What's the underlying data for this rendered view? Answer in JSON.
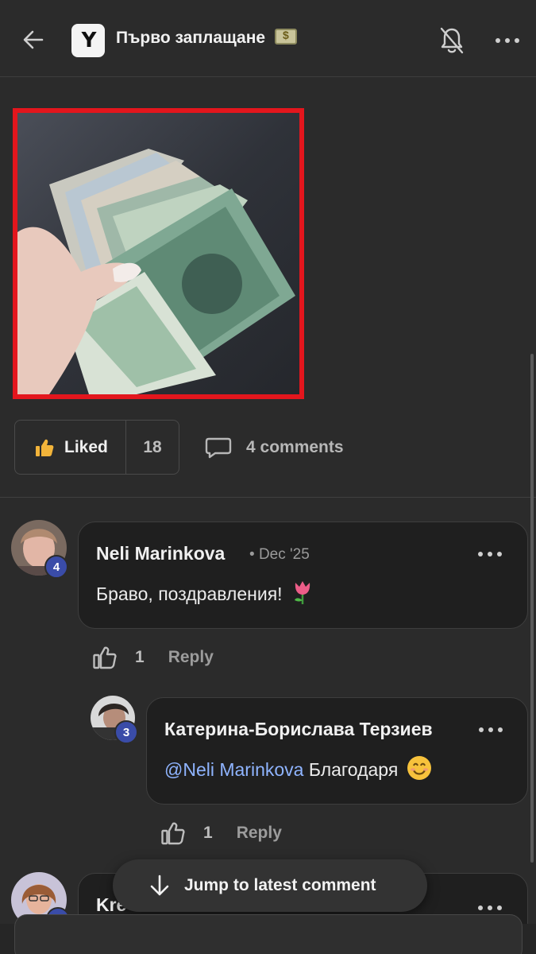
{
  "header": {
    "title": "Първо заплащане",
    "logo_text": "Y",
    "icons": {
      "back": "arrow-left-icon",
      "bell": "bell-off-icon",
      "more": "more-horizontal-icon",
      "title_emoji": "money-emoji"
    }
  },
  "post": {
    "image_alt": "banknotes-photo",
    "like_label": "Liked",
    "like_count": "18",
    "comments_label": "4 comments"
  },
  "comments": [
    {
      "author": "Neli Marinkova",
      "date": "Dec '25",
      "level": "4",
      "text": "Браво, поздравления!",
      "emoji": "tulip-emoji",
      "likes": "1",
      "reply_label": "Reply"
    },
    {
      "author": "Катерина-Борислава Терзиев",
      "level": "3",
      "mention": "@Neli Marinkova",
      "text": "Благодаря",
      "emoji": "smile-emoji",
      "likes": "1",
      "reply_label": "Reply"
    },
    {
      "author_partial": "Kre",
      "level": "4"
    }
  ],
  "jump_button": {
    "label": "Jump to latest comment"
  },
  "colors": {
    "background": "#2b2b2b",
    "bubble": "#1f1f1f",
    "highlight_border": "#e3161d",
    "mention": "#8fb4ff",
    "badge": "#3a4ca8"
  }
}
